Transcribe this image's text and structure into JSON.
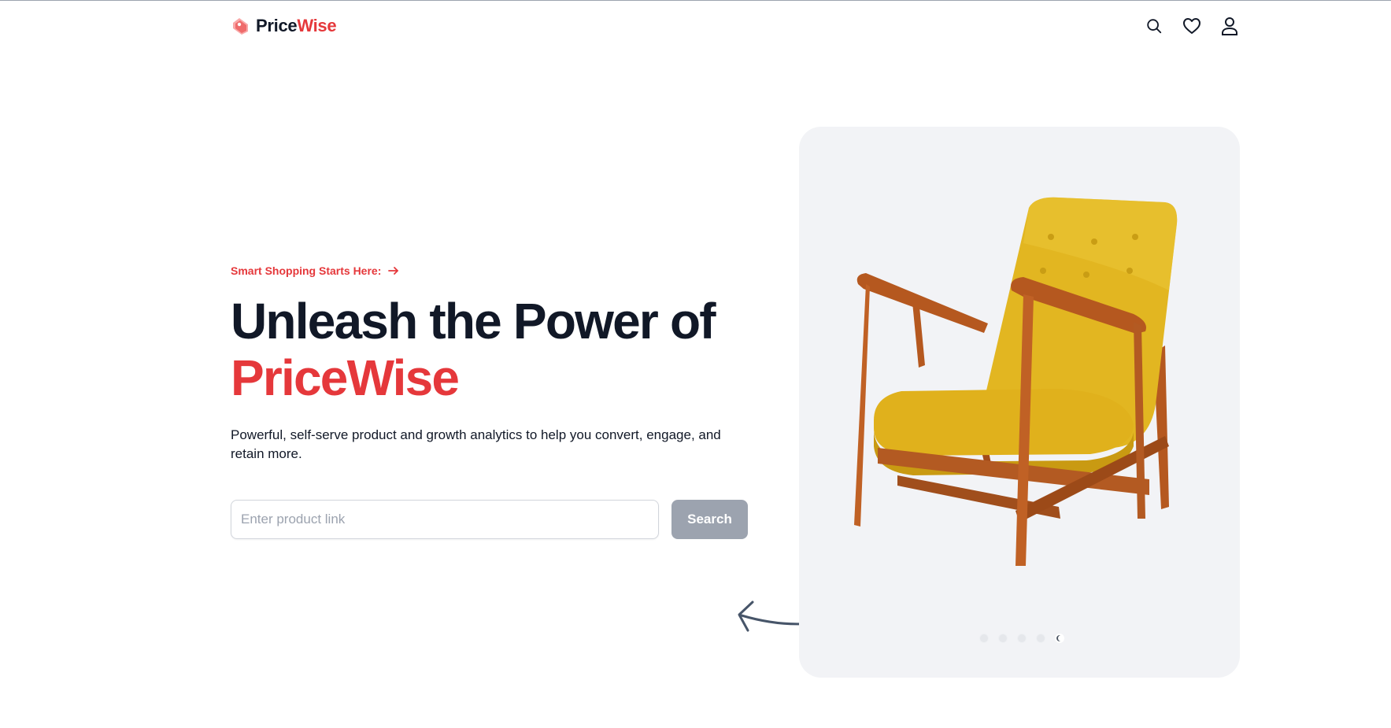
{
  "nav": {
    "brand_part1": "Price",
    "brand_part2": "Wise",
    "icons": [
      "search-icon",
      "heart-icon",
      "user-icon"
    ]
  },
  "hero": {
    "tagline": "Smart Shopping Starts Here:",
    "headline_line1": "Unleash the Power of",
    "headline_accent": "PriceWise",
    "subtext": "Powerful, self-serve product and growth analytics to help you convert, engage, and retain more."
  },
  "search": {
    "placeholder": "Enter product link",
    "value": "",
    "button_label": "Search"
  },
  "carousel": {
    "image": "yellow-armchair",
    "slide_count": 5,
    "active_slide": 5
  },
  "colors": {
    "accent": "#e5383b",
    "text": "#111827",
    "button_disabled": "#9ca3af",
    "carousel_bg": "#f2f3f6"
  }
}
